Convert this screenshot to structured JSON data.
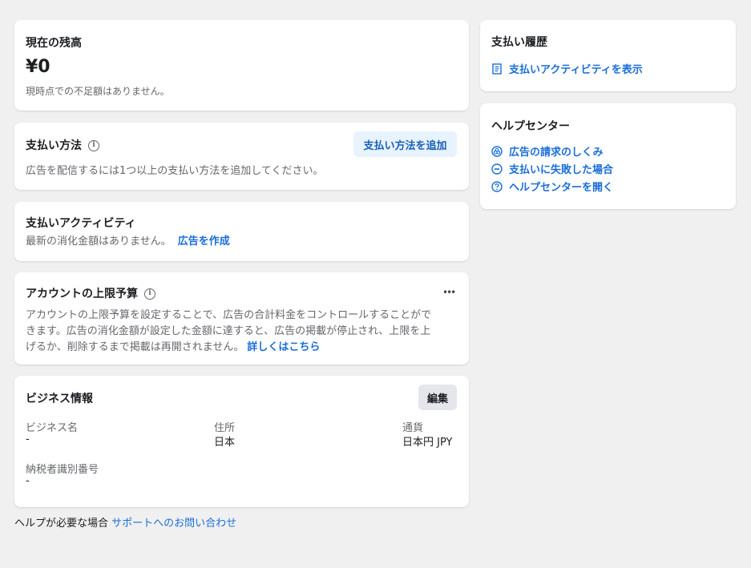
{
  "balance": {
    "title": "現在の残高",
    "amount": "¥0",
    "note": "現時点での不足額はありません。"
  },
  "payment_method": {
    "title": "支払い方法",
    "add_button": "支払い方法を追加",
    "description": "広告を配信するには1つ以上の支払い方法を追加してください。"
  },
  "payment_activity": {
    "title": "支払いアクティビティ",
    "text": "最新の消化金額はありません。",
    "link": "広告を作成"
  },
  "account_limit": {
    "title": "アカウントの上限予算",
    "line1": "アカウントの上限予算を設定することで、広告の合計料金をコントロールすることがで",
    "line2": "きます。広告の消化金額が設定した金額に達すると、広告の掲載が停止され、上限を上",
    "line3": "げるか、削除するまで掲載は再開されません。",
    "link": "詳しくはこちら",
    "more": "•••"
  },
  "business": {
    "title": "ビジネス情報",
    "edit_button": "編集",
    "fields": [
      {
        "label": "ビジネス名",
        "value": "-"
      },
      {
        "label": "住所",
        "value": "日本"
      },
      {
        "label": "通貨",
        "value": "日本円 JPY"
      },
      {
        "label": "納税者識別番号",
        "value": "-"
      }
    ]
  },
  "footer": {
    "text": "ヘルプが必要な場合",
    "link": "サポートへのお問い合わせ"
  },
  "payment_history": {
    "title": "支払い履歴",
    "link": "支払いアクティビティを表示"
  },
  "help_center": {
    "title": "ヘルプセンター",
    "items": [
      {
        "label": "広告の請求のしくみ",
        "icon": "coins-icon"
      },
      {
        "label": "支払いに失敗した場合",
        "icon": "minus-circle-icon"
      },
      {
        "label": "ヘルプセンターを開く",
        "icon": "question-circle-icon"
      }
    ]
  },
  "colors": {
    "link": "#1a6ed8",
    "background": "#f0f0f0",
    "card": "#ffffff",
    "blue_button_bg": "#e7f3ff",
    "gray_button_bg": "#e4e6eb"
  }
}
